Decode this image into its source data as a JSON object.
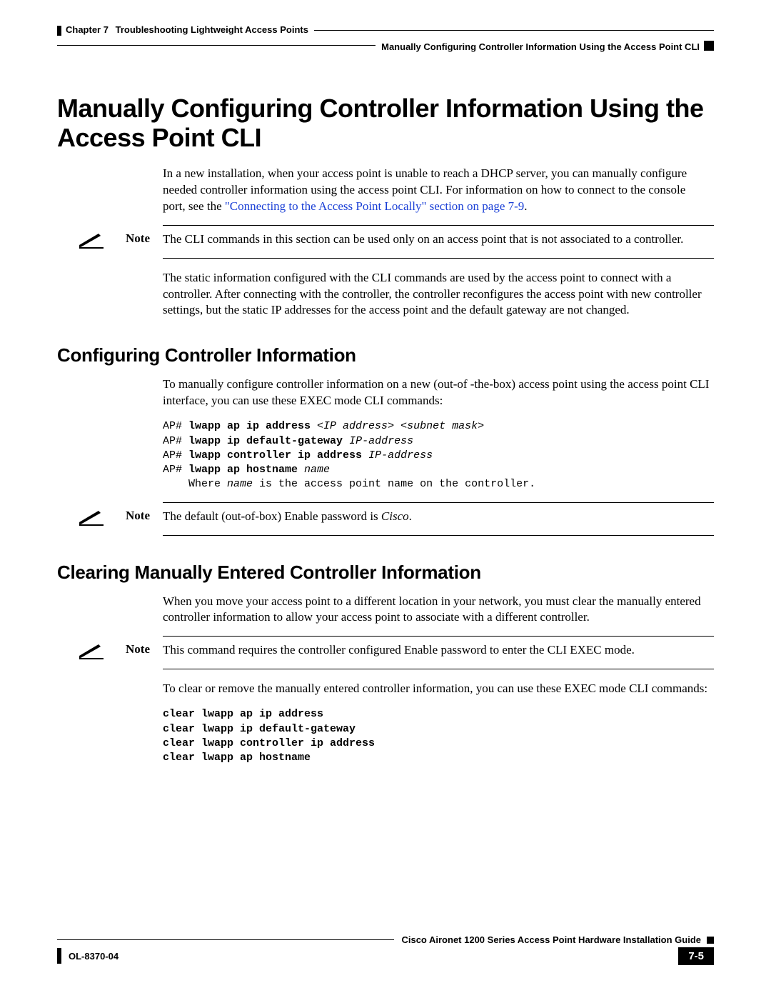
{
  "header": {
    "chapter_label": "Chapter 7",
    "chapter_title": "Troubleshooting Lightweight Access Points",
    "breadcrumb": "Manually Configuring Controller Information Using the Access Point CLI"
  },
  "h1": "Manually Configuring Controller Information Using the Access Point CLI",
  "intro": {
    "p1a": "In a new installation, when your access point is unable to reach a DHCP server, you can manually configure needed controller information using the access point CLI. For information on how to connect to the console port, see the ",
    "p1_link": "\"Connecting to the Access Point Locally\" section on page 7-9",
    "p1b": "."
  },
  "note1": {
    "label": "Note",
    "text": "The CLI commands in this section can be used only on an access point that is not associated to a controller."
  },
  "para_after_note1": "The static information configured with the CLI commands are used by the access point to connect with a controller. After connecting with the controller, the controller reconfigures the access point with new controller settings, but the static IP addresses for the access point and the default gateway are not changed.",
  "sec1": {
    "title": "Configuring Controller Information",
    "p1": "To manually configure controller information on a new (out-of -the-box) access point using the access point CLI interface, you can use these EXEC mode CLI commands:",
    "cli": {
      "l1_pre": "AP# ",
      "l1_cmd": "lwapp ap ip address ",
      "l1_arg": "<IP address> <subnet mask>",
      "l2_pre": "AP# ",
      "l2_cmd": "lwapp ip default-gateway ",
      "l2_arg": "IP-address",
      "l3_pre": "AP# ",
      "l3_cmd": "lwapp controller ip address ",
      "l3_arg": "IP-address",
      "l4_pre": "AP# ",
      "l4_cmd": "lwapp ap hostname ",
      "l4_arg": "name",
      "l5_a": "    Where ",
      "l5_b": "name",
      "l5_c": " is the access point name on the controller."
    }
  },
  "note2": {
    "label": "Note",
    "text_a": "The default (out-of-box) Enable password is ",
    "text_ital": "Cisco",
    "text_b": "."
  },
  "sec2": {
    "title": "Clearing Manually Entered Controller Information",
    "p1": "When you move your access point to a different location in your network, you must clear the manually entered controller information to allow your access point to associate with a different controller."
  },
  "note3": {
    "label": "Note",
    "text": "This command requires the controller configured Enable password to enter the CLI EXEC mode."
  },
  "sec2b": {
    "p2": "To clear or remove the manually entered controller information, you can use these EXEC mode CLI commands:",
    "cli": {
      "l1": "clear lwapp ap ip address",
      "l2": "clear lwapp ip default-gateway",
      "l3": "clear lwapp controller ip address",
      "l4": "clear lwapp ap hostname"
    }
  },
  "footer": {
    "guide": "Cisco Aironet 1200 Series Access Point Hardware Installation Guide",
    "docnum": "OL-8370-04",
    "pagenum": "7-5"
  }
}
